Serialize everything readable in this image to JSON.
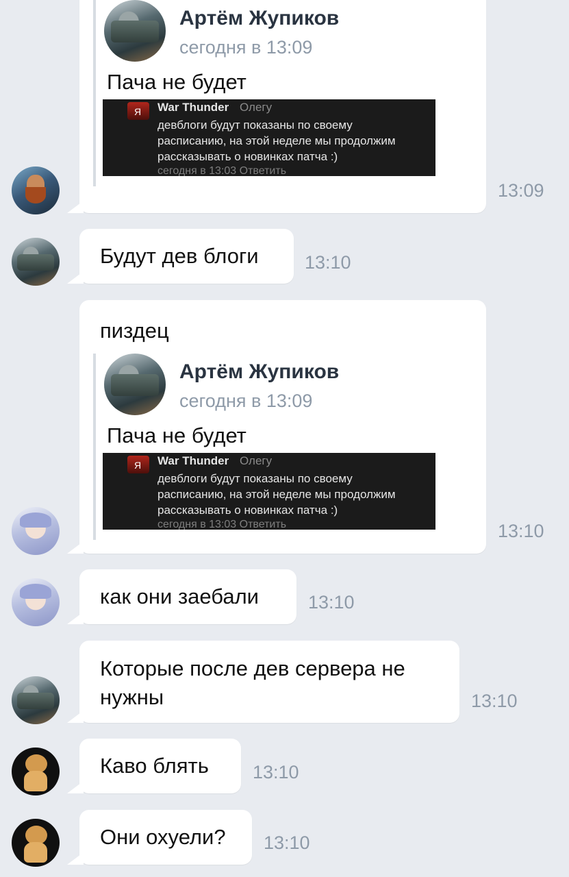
{
  "quoted": {
    "author": "Артём Жупиков",
    "date": "сегодня в 13:09",
    "text": "Пача не будет",
    "screenshot": {
      "name": "War Thunder",
      "to": "Олегу",
      "lines": [
        "девблоги будут показаны по своему",
        "расписанию, на этой неделе мы продолжим",
        "рассказывать о новинках патча :)"
      ],
      "footer": "сегодня в 13:03   Ответить"
    }
  },
  "messages": [
    {
      "time": "13:09"
    },
    {
      "text": "Будут дев блоги",
      "time": "13:10"
    },
    {
      "text": "пиздец",
      "time": "13:10"
    },
    {
      "text": "как они заебали",
      "time": "13:10"
    },
    {
      "text_lines": [
        "Которые после дев сервера не",
        "нужны"
      ],
      "time": "13:10"
    },
    {
      "text": "Каво блять",
      "time": "13:10"
    },
    {
      "text": "Они охуели?",
      "time": "13:10"
    }
  ]
}
